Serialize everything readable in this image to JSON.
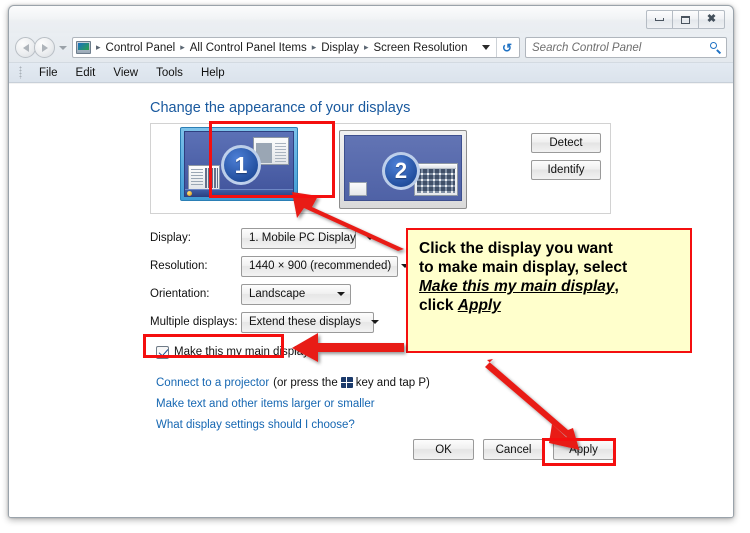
{
  "window": {
    "controls": {
      "minimize": "Minimize",
      "maximize": "Maximize",
      "close": "Close"
    }
  },
  "addressbar": {
    "breadcrumbs": [
      "Control Panel",
      "All Control Panel Items",
      "Display",
      "Screen Resolution"
    ],
    "separator": "▸",
    "refresh_icon": "refresh-icon",
    "dropdown_icon": "chevron-down-icon",
    "back_icon": "back-arrow-icon",
    "forward_icon": "forward-arrow-icon"
  },
  "search": {
    "placeholder": "Search Control Panel",
    "icon": "search-icon"
  },
  "menubar": {
    "items": [
      "File",
      "Edit",
      "View",
      "Tools",
      "Help"
    ]
  },
  "main": {
    "page_title": "Change the appearance of your displays",
    "monitors": [
      {
        "number": "1",
        "selected": true,
        "label": "display-preview-1"
      },
      {
        "number": "2",
        "selected": false,
        "label": "display-preview-2"
      }
    ],
    "detect_button": "Detect",
    "identify_button": "Identify",
    "form": [
      {
        "label": "Display:",
        "value": "1. Mobile PC Display"
      },
      {
        "label": "Resolution:",
        "value": "1440 × 900 (recommended)"
      },
      {
        "label": "Orientation:",
        "value": "Landscape"
      },
      {
        "label": "Multiple displays:",
        "value": "Extend these displays"
      }
    ],
    "checkbox": {
      "label": "Make this my main display",
      "checked": true
    },
    "links": {
      "projector_prefix": "Connect to a projector",
      "projector_mid": "(or press the",
      "projector_key_icon": "windows-logo-key-icon",
      "projector_suffix": "key and tap P)",
      "text_size": "Make text and other items larger or smaller",
      "settings_help": "What display settings should I choose?"
    },
    "buttons": {
      "ok": "OK",
      "cancel": "Cancel",
      "apply": "Apply"
    }
  },
  "annotation": {
    "callout": {
      "line1": "Click the display you want",
      "line2": "to make main display, select",
      "line3_em": "Make this my main display",
      "line3_tail": ",",
      "line4_lead": "click ",
      "line4_em": "Apply"
    },
    "highlight_color": "#f40f0f",
    "callout_bg": "#ffffcc"
  }
}
